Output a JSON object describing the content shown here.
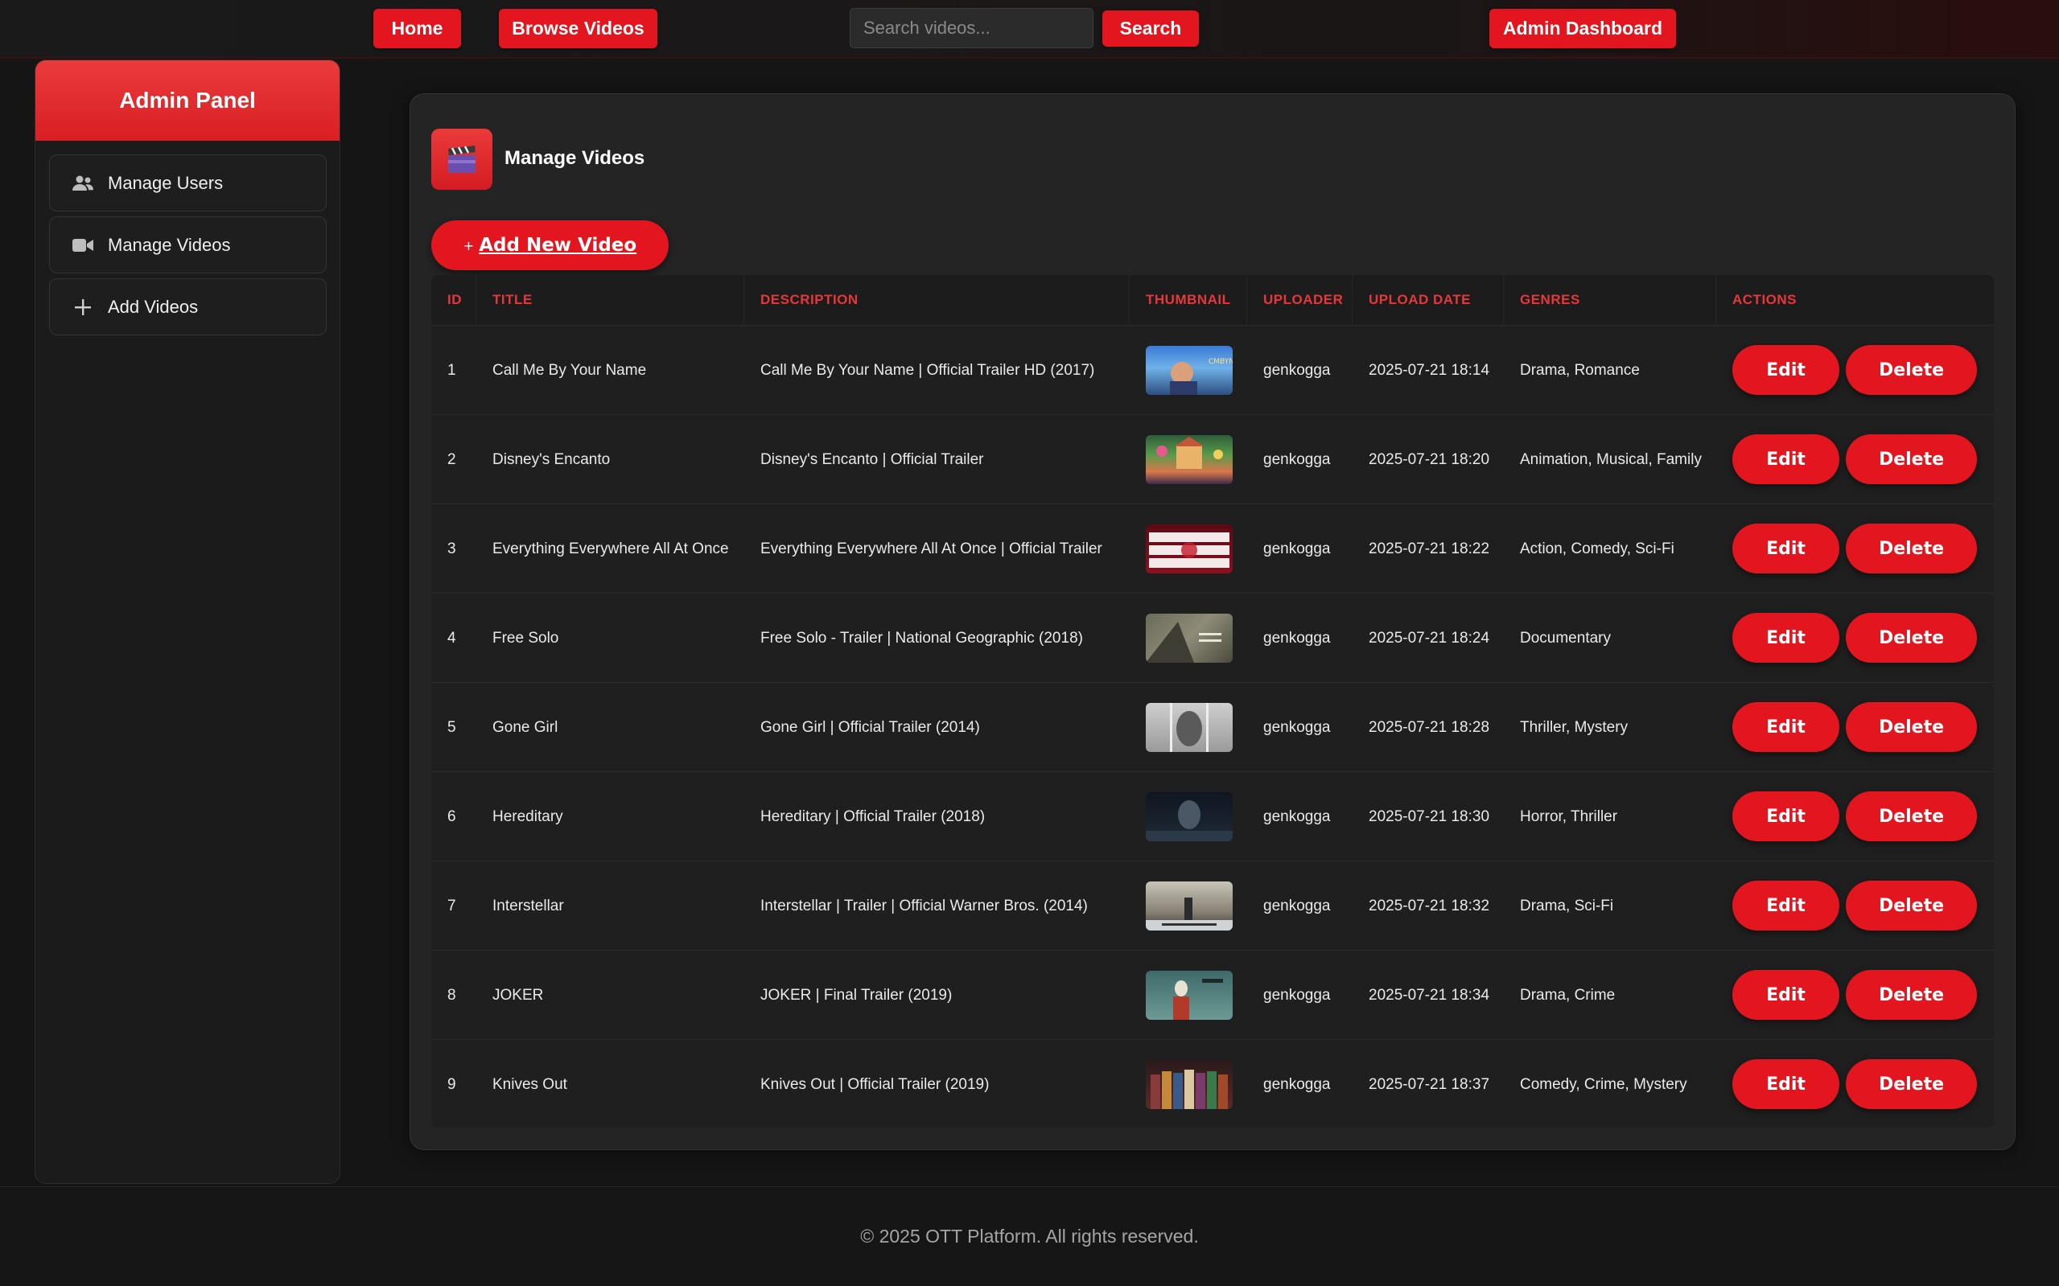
{
  "nav": {
    "home_label": "Home",
    "browse_label": "Browse Videos",
    "search_placeholder": "Search videos...",
    "search_label": "Search",
    "admin_label": "Admin Dashboard"
  },
  "sidebar": {
    "title": "Admin Panel",
    "items": [
      {
        "label": "Manage Users",
        "icon": "users-icon"
      },
      {
        "label": "Manage Videos",
        "icon": "video-camera-icon"
      },
      {
        "label": "Add Videos",
        "icon": "plus-icon"
      }
    ]
  },
  "main": {
    "title": "Manage Videos",
    "title_icon": "clapperboard-icon",
    "add_plus": "+",
    "add_label": "Add New Video",
    "columns": [
      "ID",
      "TITLE",
      "DESCRIPTION",
      "THUMBNAIL",
      "UPLOADER",
      "UPLOAD DATE",
      "GENRES",
      "ACTIONS"
    ],
    "edit_label": "Edit",
    "delete_label": "Delete",
    "rows": [
      {
        "id": "1",
        "title": "Call Me By Your Name",
        "description": "Call Me By Your Name | Official Trailer HD (2017)",
        "uploader": "genkogga",
        "date": "2025-07-21 18:14",
        "genres": "Drama, Romance"
      },
      {
        "id": "2",
        "title": "Disney's Encanto",
        "description": "Disney's Encanto  |  Official Trailer",
        "uploader": "genkogga",
        "date": "2025-07-21 18:20",
        "genres": "Animation, Musical, Family"
      },
      {
        "id": "3",
        "title": "Everything Everywhere All At Once",
        "description": "Everything Everywhere All At Once  |  Official Trailer",
        "uploader": "genkogga",
        "date": "2025-07-21 18:22",
        "genres": "Action, Comedy, Sci-Fi"
      },
      {
        "id": "4",
        "title": "Free Solo",
        "description": "Free Solo - Trailer  |  National Geographic (2018)",
        "uploader": "genkogga",
        "date": "2025-07-21 18:24",
        "genres": "Documentary"
      },
      {
        "id": "5",
        "title": "Gone Girl",
        "description": "Gone Girl | Official Trailer (2014)",
        "uploader": "genkogga",
        "date": "2025-07-21 18:28",
        "genres": "Thriller, Mystery"
      },
      {
        "id": "6",
        "title": "Hereditary",
        "description": "Hereditary | Official Trailer (2018)",
        "uploader": "genkogga",
        "date": "2025-07-21 18:30",
        "genres": "Horror, Thriller"
      },
      {
        "id": "7",
        "title": "Interstellar",
        "description": "Interstellar | Trailer | Official Warner Bros. (2014)",
        "uploader": "genkogga",
        "date": "2025-07-21 18:32",
        "genres": "Drama, Sci-Fi"
      },
      {
        "id": "8",
        "title": "JOKER",
        "description": "JOKER | Final Trailer (2019)",
        "uploader": "genkogga",
        "date": "2025-07-21 18:34",
        "genres": "Drama, Crime"
      },
      {
        "id": "9",
        "title": "Knives Out",
        "description": "Knives Out | Official Trailer (2019)",
        "uploader": "genkogga",
        "date": "2025-07-21 18:37",
        "genres": "Comedy, Crime, Mystery"
      }
    ]
  },
  "footer": {
    "text": "© 2025 OTT Platform. All rights reserved."
  },
  "colors": {
    "accent": "#e3151e",
    "header_text": "#e5383b",
    "background": "#151515"
  }
}
